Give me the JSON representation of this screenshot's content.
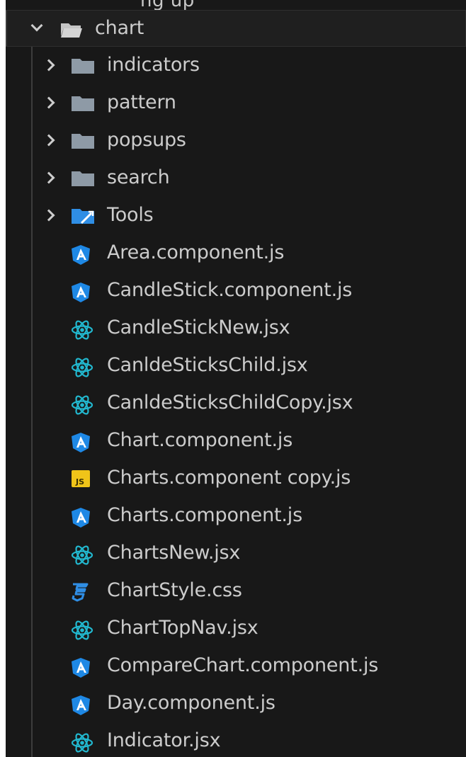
{
  "explorer": {
    "partial_top_text": "ng up",
    "root_folder": {
      "name": "chart",
      "expanded": true,
      "icon": "folder-open-icon"
    },
    "items": [
      {
        "kind": "folder",
        "name": "indicators",
        "icon": "folder-icon"
      },
      {
        "kind": "folder",
        "name": "pattern",
        "icon": "folder-icon"
      },
      {
        "kind": "folder",
        "name": "popsups",
        "icon": "folder-icon"
      },
      {
        "kind": "folder",
        "name": "search",
        "icon": "folder-icon"
      },
      {
        "kind": "folder",
        "name": "Tools",
        "icon": "tools-folder-icon"
      },
      {
        "kind": "file",
        "name": "Area.component.js",
        "icon": "angular-icon"
      },
      {
        "kind": "file",
        "name": "CandleStick.component.js",
        "icon": "angular-icon"
      },
      {
        "kind": "file",
        "name": "CandleStickNew.jsx",
        "icon": "react-icon"
      },
      {
        "kind": "file",
        "name": "CanldeSticksChild.jsx",
        "icon": "react-icon"
      },
      {
        "kind": "file",
        "name": "CanldeSticksChildCopy.jsx",
        "icon": "react-icon"
      },
      {
        "kind": "file",
        "name": "Chart.component.js",
        "icon": "angular-icon"
      },
      {
        "kind": "file",
        "name": "Charts.component copy.js",
        "icon": "js-icon"
      },
      {
        "kind": "file",
        "name": "Charts.component.js",
        "icon": "angular-icon"
      },
      {
        "kind": "file",
        "name": "ChartsNew.jsx",
        "icon": "react-icon"
      },
      {
        "kind": "file",
        "name": "ChartStyle.css",
        "icon": "css-icon"
      },
      {
        "kind": "file",
        "name": "ChartTopNav.jsx",
        "icon": "react-icon"
      },
      {
        "kind": "file",
        "name": "CompareChart.component.js",
        "icon": "angular-icon"
      },
      {
        "kind": "file",
        "name": "Day.component.js",
        "icon": "angular-icon"
      },
      {
        "kind": "file",
        "name": "Indicator.jsx",
        "icon": "react-icon"
      }
    ]
  },
  "colors": {
    "panel_bg": "#181818",
    "text": "#cccccc",
    "folder": "#8e9aa6",
    "tools_folder": "#2f8ee5",
    "angular": "#1e88e5",
    "react": "#22b8cf",
    "js_bg": "#f0c419",
    "css": "#2f8ee5"
  }
}
